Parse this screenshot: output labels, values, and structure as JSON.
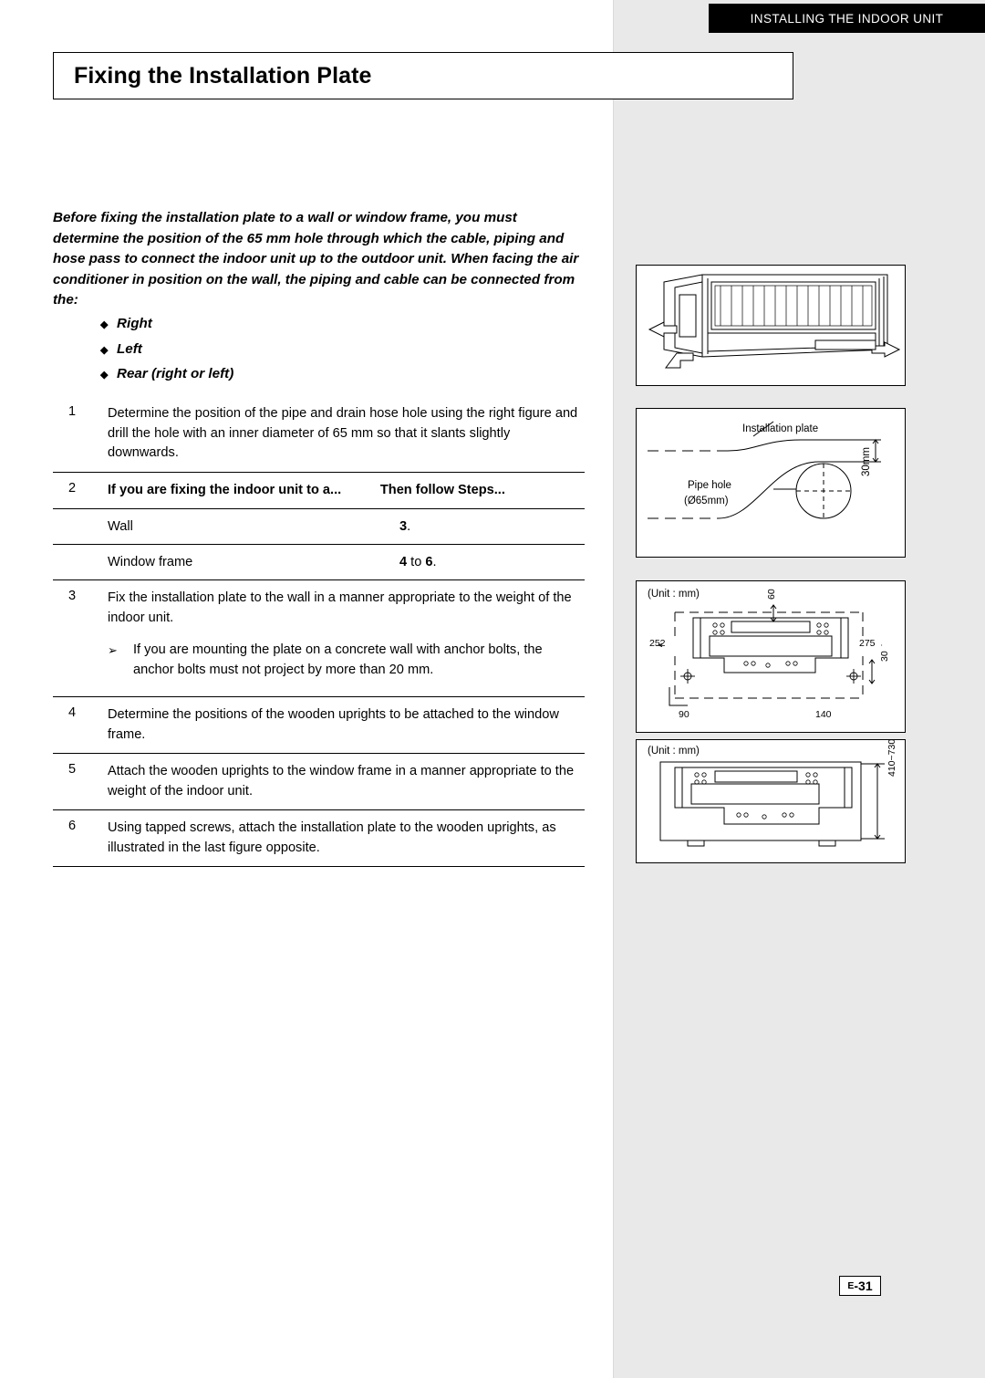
{
  "header": {
    "running_title": "INSTALLING THE INDOOR UNIT"
  },
  "page": {
    "title": "Fixing the Installation Plate",
    "number": "E-31",
    "number_prefix": "E",
    "number_suffix": "-31"
  },
  "intro": {
    "paragraph": "Before fixing the installation plate to a wall or window frame, you must determine the position of the 65 mm hole through which the cable, piping and hose pass to connect the indoor unit up to the outdoor unit. When facing the air conditioner in position on the wall, the piping and cable can be connected from the:",
    "bullets": [
      "Right",
      "Left",
      "Rear (right or left)"
    ]
  },
  "steps": [
    {
      "num": "1",
      "text": "Determine the position of the pipe and drain hose hole using the right figure and drill the hole with an inner diameter of 65 mm so that it slants slightly downwards."
    },
    {
      "num": "2",
      "col1_header": "If you are fixing the indoor unit to a...",
      "col2_header": "Then follow Steps...",
      "rows": [
        {
          "c1": "Wall",
          "c2_bold": "3",
          "c2_rest": "."
        },
        {
          "c1": "Window frame",
          "c2_bold": "4",
          "c2_mid": " to ",
          "c2_bold2": "6",
          "c2_rest": "."
        }
      ]
    },
    {
      "num": "3",
      "text": "Fix the installation plate to the wall in a manner appropriate to the weight of the indoor unit.",
      "substep": "If you are mounting the plate on a concrete wall with anchor bolts, the anchor bolts must not project by more than 20 mm."
    },
    {
      "num": "4",
      "text": "Determine the positions of the wooden uprights to be attached to the window frame."
    },
    {
      "num": "5",
      "text": "Attach the wooden uprights to the window frame in a manner appropriate to the weight of the indoor unit."
    },
    {
      "num": "6",
      "text": "Using tapped screws, attach the installation plate to the wooden uprights, as illustrated in the last figure opposite."
    }
  ],
  "figures": {
    "fig1": {
      "name": "indoor-unit-side-view"
    },
    "fig2": {
      "name": "pipe-hole-dimensions",
      "labels": {
        "installation_plate": "Installation plate",
        "pipe_hole": "Pipe hole",
        "pipe_hole_dia": "(Ø65mm)",
        "dim_30": "30mm"
      }
    },
    "fig3": {
      "name": "installation-plate-dimensions-top",
      "unit": "(Unit : mm)",
      "dims": {
        "left": "252",
        "right": "275",
        "top": "60",
        "right_lower": "30",
        "bottom_left": "90",
        "bottom_right": "140"
      }
    },
    "fig4": {
      "name": "installation-plate-dimensions-bottom",
      "unit": "(Unit : mm)",
      "dims": {
        "right": "410~730"
      }
    }
  }
}
